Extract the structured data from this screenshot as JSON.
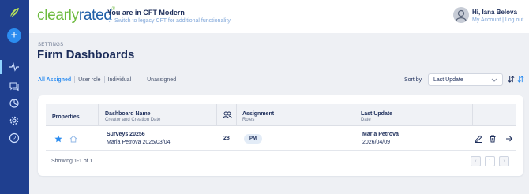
{
  "brand": {
    "name_part1": "clearly",
    "name_part2": "rated",
    "trademark": "®"
  },
  "header": {
    "cft_title": "You are in CFT Modern",
    "cft_switch": "Switch to legacy CFT for additional functionality",
    "user_greeting": "Hi, Iana Belova",
    "user_links": "My Account | Log out"
  },
  "sidebar": {
    "add_label": "+",
    "items": [
      {
        "icon": "activity-icon"
      },
      {
        "icon": "chat-icon"
      },
      {
        "icon": "pie-chart-icon"
      },
      {
        "icon": "gear-icon"
      },
      {
        "icon": "help-icon"
      }
    ]
  },
  "page": {
    "section": "SETTINGS",
    "title": "Firm Dashboards"
  },
  "tabs": [
    {
      "label": "All Assigned",
      "active": true
    },
    {
      "label": "User role",
      "active": false
    },
    {
      "label": "Individual",
      "active": false
    },
    {
      "label": "Unassigned",
      "active": false
    }
  ],
  "sort": {
    "label": "Sort by",
    "value": "Last Update"
  },
  "table": {
    "headers": {
      "properties": "Properties",
      "name_l1": "Dashboard Name",
      "name_l2": "Creator and Creation Date",
      "assignment_l1": "Assignment",
      "assignment_l2": "Roles",
      "update_l1": "Last Update",
      "update_l2": "Date"
    },
    "rows": [
      {
        "favorite": true,
        "name": "Surveys 20256",
        "creator_date": "Maria Petrova 2025/03/04",
        "users": "28",
        "role": "PM",
        "updated_by": "Maria Petrova",
        "updated_date": "2026/04/09"
      }
    ]
  },
  "pagination": {
    "showing": "Showing 1-1 of 1",
    "current_page": "1",
    "prev": "‹",
    "next": "›"
  },
  "colors": {
    "sidebar": "#1f3f8f",
    "accent": "#2b8cf0",
    "brand_green": "#6dbb3f",
    "brand_blue": "#1f5fa8"
  }
}
